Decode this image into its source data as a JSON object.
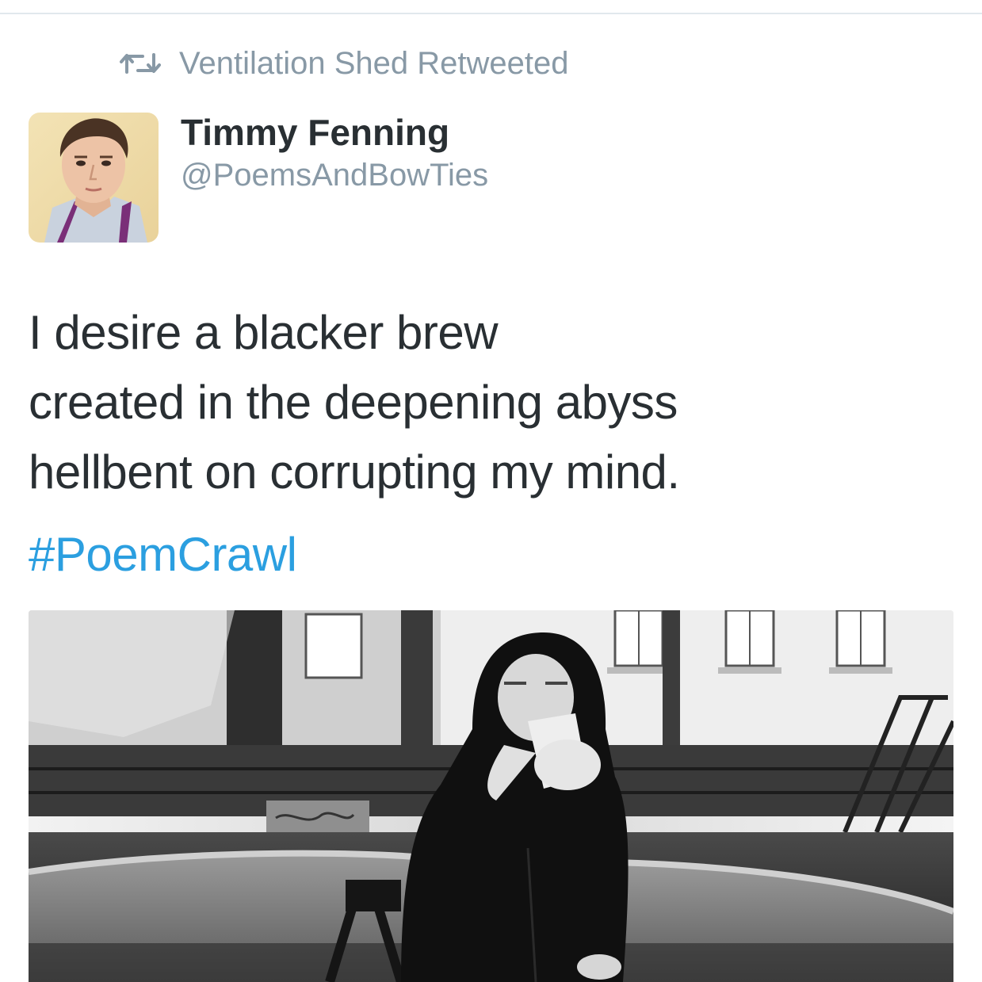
{
  "retweet": {
    "icon": "retweet-icon",
    "text": "Ventilation Shed Retweeted"
  },
  "author": {
    "display_name": "Timmy Fenning",
    "handle": "@PoemsAndBowTies",
    "avatar_icon": "profile-photo"
  },
  "tweet": {
    "lines": [
      "I desire a blacker brew",
      "created in the deepening abyss",
      "hellbent on corrupting my mind."
    ],
    "hashtag": "#PoemCrawl"
  },
  "media": {
    "kind": "black-and-white photo of hooded person drinking from a paper bag by a dry fountain"
  },
  "colors": {
    "text": "#292f33",
    "secondary": "#8899a6",
    "link": "#2b9fe0",
    "divider": "#e1e8ed"
  }
}
